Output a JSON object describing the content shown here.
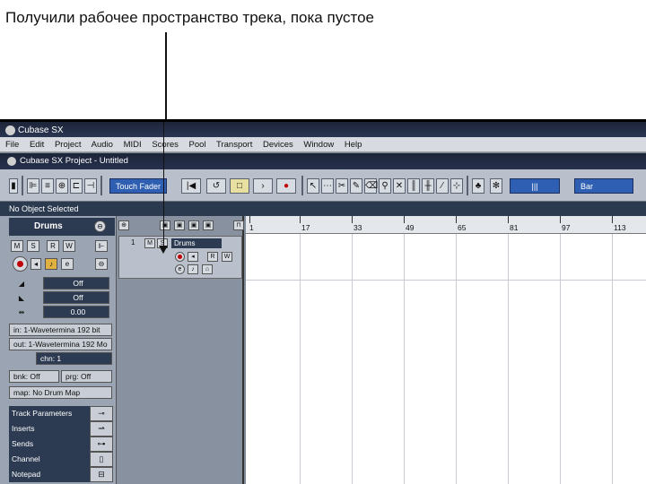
{
  "caption": "Получили рабочее пространство трека, пока пустое",
  "app": {
    "title": "Cubase SX",
    "menu": [
      "File",
      "Edit",
      "Project",
      "Audio",
      "MIDI",
      "Scores",
      "Pool",
      "Transport",
      "Devices",
      "Window",
      "Help"
    ],
    "project_title": "Cubase SX Project - Untitled"
  },
  "toolbar": {
    "mode_field": "Touch Fader",
    "quantize_field": "Bar",
    "snap_icon": "|||"
  },
  "infobar": {
    "text": "No Object Selected"
  },
  "inspector": {
    "track_name": "Drums",
    "buttons": {
      "mute": "M",
      "solo": "S",
      "read": "R",
      "write": "W",
      "edit": "e"
    },
    "volume": "Off",
    "pan": "Off",
    "delay": "0.00",
    "input": "in: 1-Wavetermina 192 bit",
    "output": "out: 1-Wavetermina 192 Mo",
    "channel": "chn: 1",
    "bank": "bnk: Off",
    "program": "prg: Off",
    "map": "map: No Drum Map",
    "sections": [
      "Track Parameters",
      "Inserts",
      "Sends",
      "Channel",
      "Notepad"
    ]
  },
  "track": {
    "number": "1",
    "name": "Drums"
  },
  "ruler": {
    "marks": [
      "1",
      "17",
      "33",
      "49",
      "65",
      "81",
      "97",
      "113"
    ]
  }
}
